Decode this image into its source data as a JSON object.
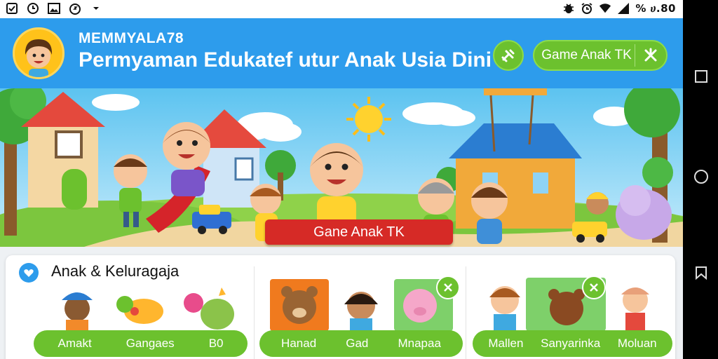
{
  "status_bar": {
    "time": "% ሀ.80",
    "left_icons": [
      "checkbox-icon",
      "clock-icon",
      "image-icon",
      "stopwatch-icon",
      "dropdown-icon"
    ],
    "right_icons": [
      "bug-icon",
      "alarm-icon",
      "wifi-icon",
      "signal-icon"
    ]
  },
  "header": {
    "username": "MEMMYALA78",
    "title": "Permyaman Edukatef utur Anak Usia Dini",
    "game_button_label": "Game Anak TK"
  },
  "banner": {
    "cta_label": "Gane Anak TK"
  },
  "content": {
    "category_title": "Anak & Keluragaja",
    "groups": [
      {
        "labels": [
          "Amakt",
          "Gangaes",
          "B0"
        ]
      },
      {
        "labels": [
          "Hanad",
          "Gad",
          "Mnapaa"
        ]
      },
      {
        "labels": [
          "Mallen",
          "Sanyarinka",
          "Moluan"
        ]
      }
    ]
  },
  "colors": {
    "header_blue": "#2d9cec",
    "accent_green": "#6cc12e",
    "cta_red": "#d62a26",
    "avatar_yellow": "#ffc21a"
  }
}
